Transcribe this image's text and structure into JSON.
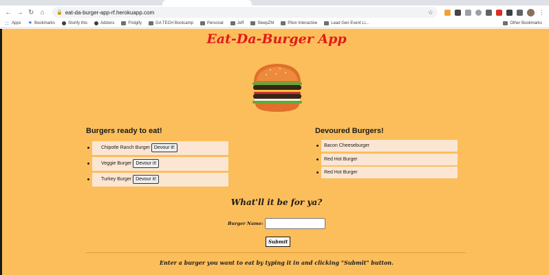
{
  "browser": {
    "url": "eat-da-burger-app-rf.herokuapp.com",
    "bookmarks": [
      {
        "label": "Apps",
        "icon": "apps-grid-icon"
      },
      {
        "label": "Bookmarks",
        "icon": "star-icon"
      },
      {
        "label": "Storify this",
        "icon": "globe-icon"
      },
      {
        "label": "Addons",
        "icon": "globe-icon"
      },
      {
        "label": "Fridgify",
        "icon": "page-icon"
      },
      {
        "label": "GA TECH Bootcamp",
        "icon": "folder-icon"
      },
      {
        "label": "Personal",
        "icon": "folder-icon"
      },
      {
        "label": "Jeff",
        "icon": "folder-icon"
      },
      {
        "label": "SleepZM",
        "icon": "folder-icon"
      },
      {
        "label": "Piton Interactive",
        "icon": "folder-icon"
      },
      {
        "label": "Lead Gen Event Li...",
        "icon": "folder-icon"
      }
    ],
    "other_bookmarks": "Other Bookmarks"
  },
  "app": {
    "title": "Eat-Da-Burger App",
    "ready_title": "Burgers ready to eat!",
    "devoured_title": "Devoured Burgers!",
    "devour_label": "Devour it!",
    "ready": [
      "Chipotle Ranch Burger",
      "Veggie Burger",
      "Turkey Burger"
    ],
    "devoured": [
      "Bacon Cheeseburger",
      "Red Hot Burger",
      "Red Hot Burger"
    ],
    "form_title": "What'll it be for ya?",
    "form_label": "Burger Name:",
    "input_value": "",
    "submit_label": "Submit",
    "hint": "Enter a burger you want to eat by typing it in and clicking \"Submit\" button."
  },
  "colors": {
    "page_bg": "#fcbe5b",
    "title": "#e11a1a",
    "item_bg": "#fbe6d3"
  }
}
